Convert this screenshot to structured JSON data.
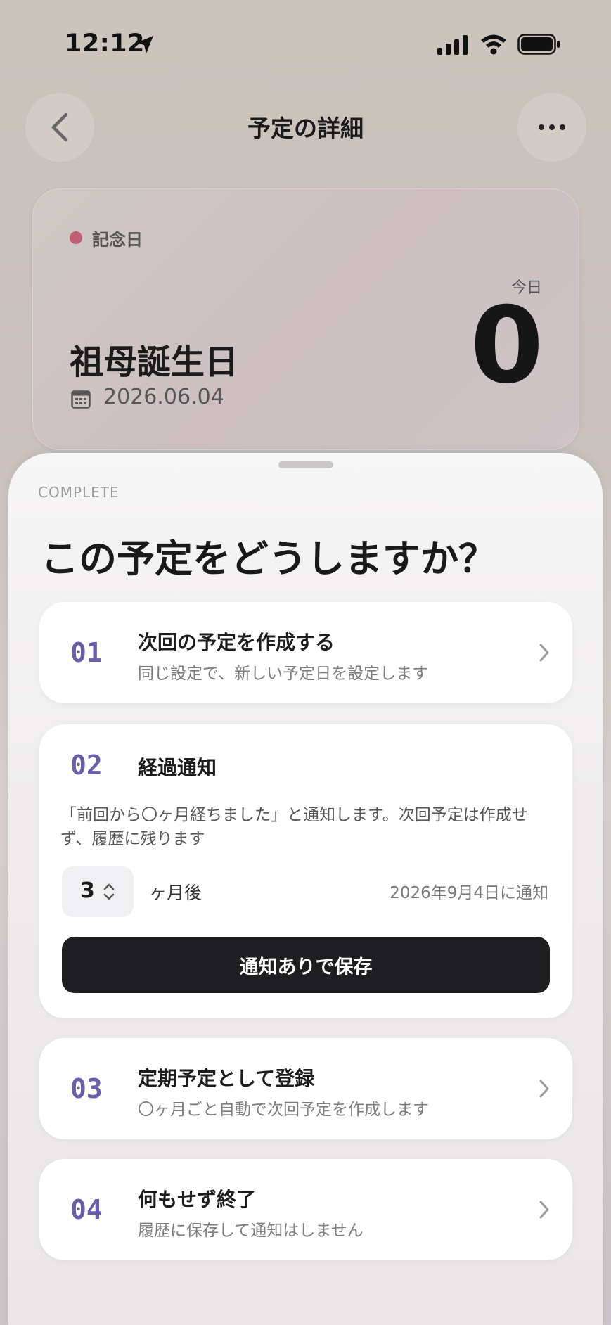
{
  "status_bar": {
    "time": "12:12"
  },
  "nav": {
    "title": "予定の詳細"
  },
  "event": {
    "category": "記念日",
    "category_color": "#bf5e78",
    "title": "祖母誕生日",
    "date": "2026.06.04",
    "today_label": "今日",
    "count": "0"
  },
  "sheet": {
    "eyebrow": "COMPLETE",
    "title": "この予定をどうしますか？",
    "options": [
      {
        "num": "01",
        "title": "次回の予定を作成する",
        "subtitle": "同じ設定で、新しい予定日を設定します"
      },
      {
        "num": "02",
        "title": "経過通知",
        "description": "「前回から〇ヶ月経ちました」と通知します。次回予定は作成せず、履歴に残ります",
        "stepper_value": "3",
        "unit_label": "ヶ月後",
        "notify_date": "2026年9月4日に通知",
        "save_button": "通知ありで保存"
      },
      {
        "num": "03",
        "title": "定期予定として登録",
        "subtitle": "〇ヶ月ごと自動で次回予定を作成します"
      },
      {
        "num": "04",
        "title": "何もせず終了",
        "subtitle": "履歴に保存して通知はしません"
      }
    ]
  },
  "colors": {
    "accent_number": "#6c5da8",
    "primary_button": "#1e1e21"
  }
}
